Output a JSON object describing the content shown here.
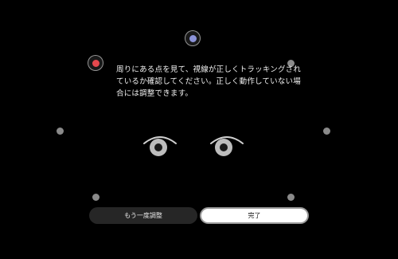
{
  "instructions": {
    "text": "周りにある点を見て、視線が正しくトラッキングされているか確認してください。正しく動作していない場合には調整できます。"
  },
  "buttons": {
    "readjust_label": "もう一度調整",
    "done_label": "完了"
  },
  "calibration_points": [
    {
      "name": "top-center",
      "state": "active-blue"
    },
    {
      "name": "top-left",
      "state": "active-red"
    },
    {
      "name": "top-right",
      "state": "idle"
    },
    {
      "name": "middle-left",
      "state": "idle"
    },
    {
      "name": "middle-right",
      "state": "idle"
    },
    {
      "name": "bottom-left",
      "state": "idle"
    },
    {
      "name": "bottom-right",
      "state": "idle"
    }
  ],
  "colors": {
    "background": "#000000",
    "point_idle": "#8a8a8a",
    "point_red": "#e5484d",
    "point_blue": "#8c93d8",
    "primary_button": "#ffffff",
    "secondary_button": "#262626"
  },
  "icons": {
    "left_eye": "eye-icon",
    "right_eye": "eye-icon"
  }
}
